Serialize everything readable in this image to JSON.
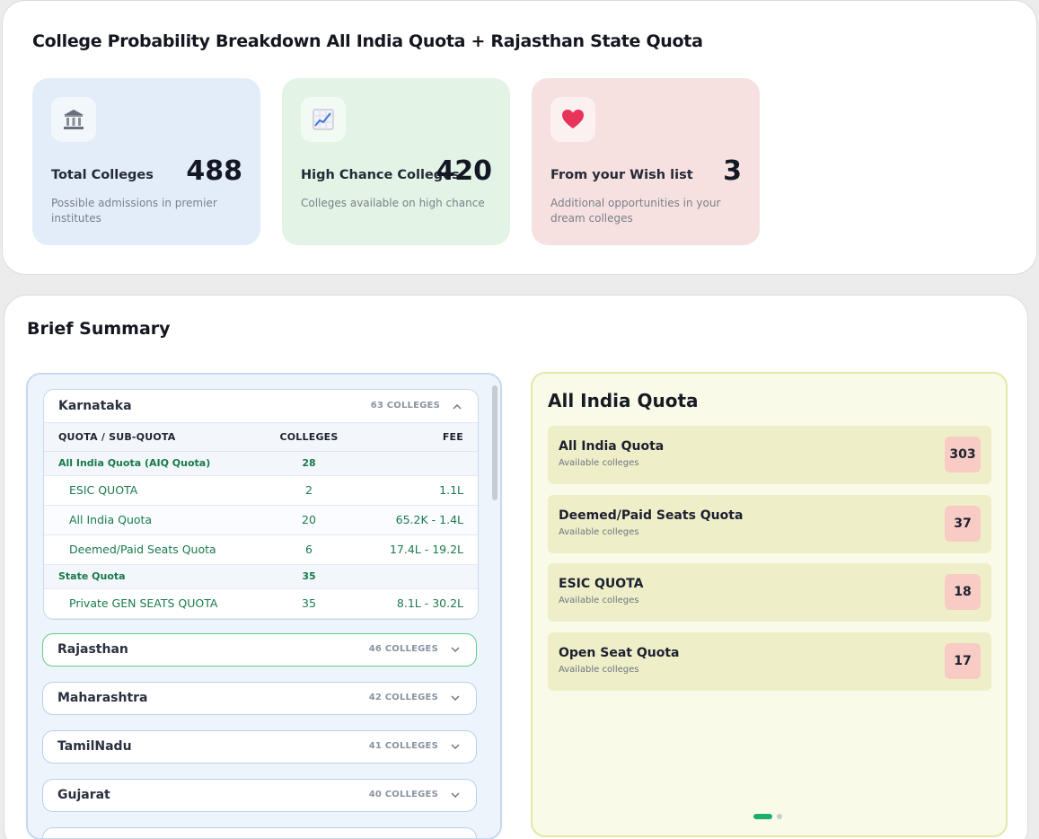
{
  "header": {
    "title": "College Probability Breakdown All India Quota + Rajasthan State Quota"
  },
  "stats": [
    {
      "label": "Total Colleges",
      "value": "488",
      "desc": "Possible admissions in premier institutes",
      "icon": "bank-icon"
    },
    {
      "label": "High Chance Colleges",
      "value": "420",
      "desc": "Colleges available on high chance",
      "icon": "chart-up-icon"
    },
    {
      "label": "From your Wish list",
      "value": "3",
      "desc": "Additional opportunities in your dream colleges",
      "icon": "heart-icon"
    }
  ],
  "summary": {
    "title": "Brief Summary",
    "table_headers": {
      "quota": "QUOTA / SUB-QUOTA",
      "colleges": "COLLEGES",
      "fee": "FEE"
    },
    "open_state": {
      "name": "Karnataka",
      "count": "63 COLLEGES",
      "rows": [
        {
          "type": "group",
          "quota": "All India Quota (AIQ Quota)",
          "colleges": "28",
          "fee": ""
        },
        {
          "type": "sub",
          "quota": "ESIC QUOTA",
          "colleges": "2",
          "fee": "1.1L"
        },
        {
          "type": "sub",
          "quota": "All India Quota",
          "colleges": "20",
          "fee": "65.2K - 1.4L"
        },
        {
          "type": "sub",
          "quota": "Deemed/Paid Seats Quota",
          "colleges": "6",
          "fee": "17.4L - 19.2L"
        },
        {
          "type": "group",
          "quota": "State Quota",
          "colleges": "35",
          "fee": ""
        },
        {
          "type": "sub",
          "quota": "Private GEN SEATS QUOTA",
          "colleges": "35",
          "fee": "8.1L - 30.2L"
        }
      ]
    },
    "states": [
      {
        "name": "Rajasthan",
        "count": "46 COLLEGES"
      },
      {
        "name": "Maharashtra",
        "count": "42 COLLEGES"
      },
      {
        "name": "TamilNadu",
        "count": "41 COLLEGES"
      },
      {
        "name": "Gujarat",
        "count": "40 COLLEGES"
      }
    ]
  },
  "quota_panel": {
    "title": "All India Quota",
    "sub_label": "Available colleges",
    "items": [
      {
        "name": "All India Quota",
        "count": "303"
      },
      {
        "name": "Deemed/Paid Seats Quota",
        "count": "37"
      },
      {
        "name": "ESIC QUOTA",
        "count": "18"
      },
      {
        "name": "Open Seat Quota",
        "count": "17"
      }
    ],
    "pagination": {
      "active_page": 1,
      "total_pages": 2
    }
  },
  "colors": {
    "accent_green": "#19b06a",
    "fee_green": "#1a7a4c",
    "badge_pink": "#f8cbc4"
  }
}
